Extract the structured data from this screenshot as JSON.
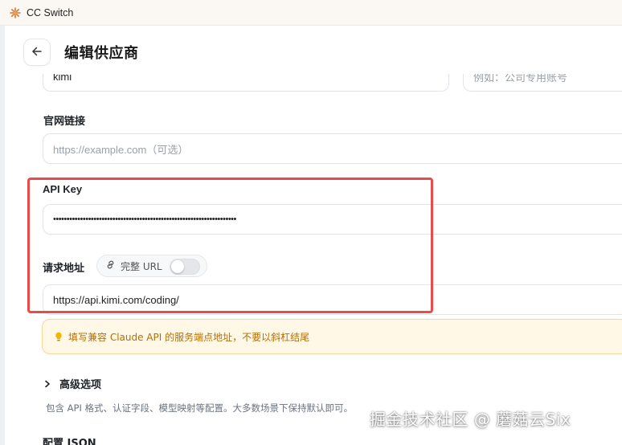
{
  "window": {
    "title": "CC Switch",
    "logo_icon": "sunburst-logo-icon"
  },
  "header": {
    "title": "编辑供应商",
    "back_icon": "arrow-left-icon"
  },
  "form": {
    "name_value": "kimi",
    "notes_placeholder": "例如：公司专用账号",
    "website_label": "官网链接",
    "website_placeholder": "https://example.com（可选）",
    "api_key_label": "API Key",
    "api_key_value": "••••••••••••••••••••••••••••••••••••••••••••••••••••••••••••••••••••",
    "endpoint_label": "请求地址",
    "full_url_toggle_label": "完整 URL",
    "full_url_toggle_on": false,
    "endpoint_value": "https://api.kimi.com/coding/",
    "tip_text": "填写兼容 Claude API 的服务端点地址，不要以斜杠结尾",
    "advanced_label": "高级选项",
    "advanced_desc": "包含 API 格式、认证字段、模型映射等配置。大多数场景下保持默认即可。",
    "config_json_label": "配置 JSON"
  },
  "overlay": {
    "watermark": "掘金技术社区 @ 蘑菇云Six",
    "highlight_color": "#e94b4b"
  },
  "colors": {
    "tip_bg": "#fff8e7",
    "tip_text": "#b76e00"
  }
}
